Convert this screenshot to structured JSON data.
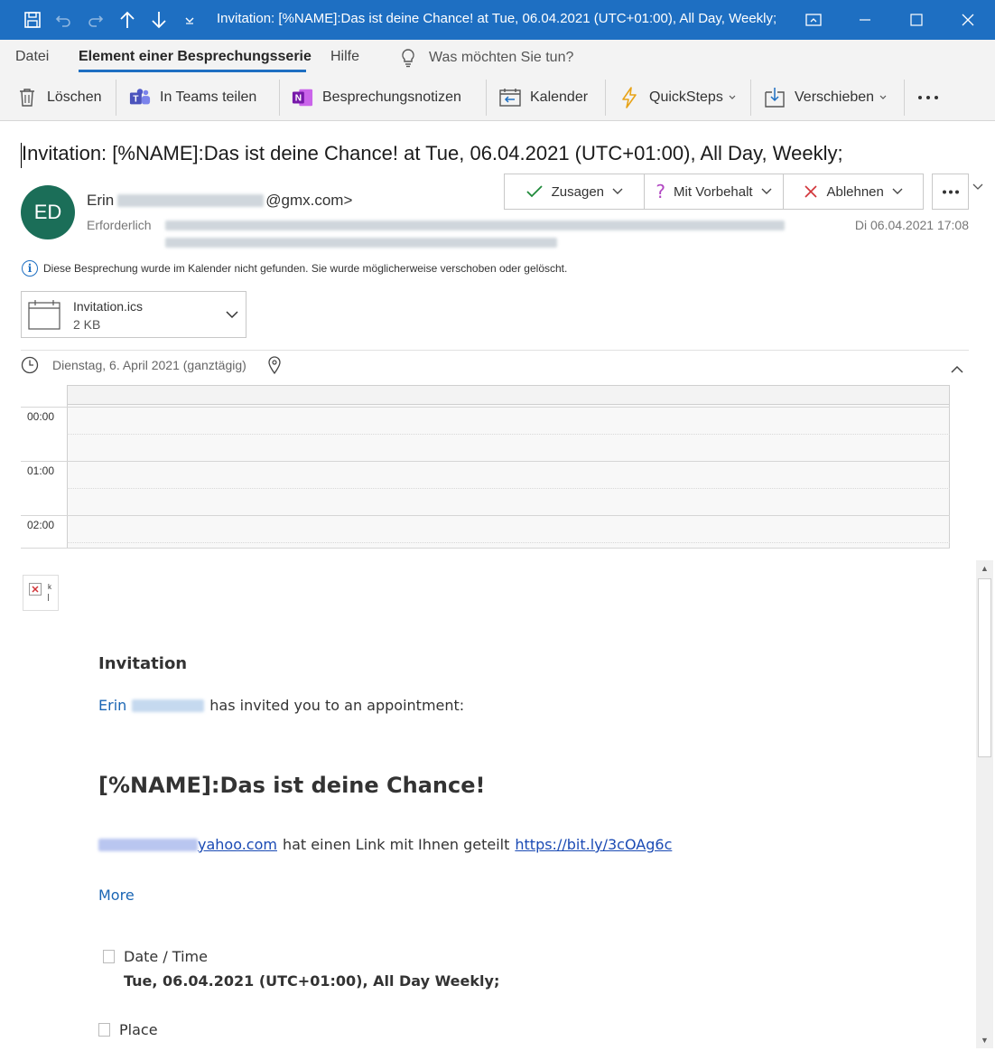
{
  "window": {
    "title": "Invitation: [%NAME]:Das ist deine Chance! at Tue, 06.04.2021 (UTC+01:00), All Day, Weekly;..."
  },
  "menu": {
    "tabs": [
      "Datei",
      "Element einer Besprechungsserie",
      "Hilfe"
    ],
    "tell_me": "Was möchten Sie tun?"
  },
  "ribbon": {
    "delete": "Löschen",
    "teams": "In Teams teilen",
    "notes": "Besprechungsnotizen",
    "calendar": "Kalender",
    "quicksteps": "QuickSteps",
    "move": "Verschieben"
  },
  "message": {
    "subject": "Invitation: [%NAME]:Das ist deine Chance! at Tue, 06.04.2021 (UTC+01:00), All Day, Weekly;",
    "avatar_initials": "ED",
    "sender_first": "Erin",
    "sender_domain": "@gmx.com>",
    "required_label": "Erforderlich",
    "received": "Di 06.04.2021 17:08",
    "responses": {
      "accept": "Zusagen",
      "tentative": "Mit Vorbehalt",
      "decline": "Ablehnen"
    },
    "info": "Diese Besprechung wurde im Kalender nicht gefunden. Sie wurde möglicherweise verschoben oder gelöscht.",
    "attachment": {
      "name": "Invitation.ics",
      "size": "2 KB"
    },
    "when": "Dienstag, 6. April 2021 (ganztägig)"
  },
  "calendar_preview": {
    "times": [
      "00:00",
      "01:00",
      "02:00"
    ]
  },
  "body": {
    "heading": "Invitation",
    "inviter": "Erin",
    "invite_text": "has invited you to an appointment:",
    "event_title": "[%NAME]:Das ist deine Chance!",
    "email_suffix": "yahoo.com",
    "share_text": "hat einen Link mit Ihnen geteilt",
    "share_link": "https://bit.ly/3cOAg6c",
    "more": "More",
    "datetime_label": "Date / Time",
    "datetime_value": "Tue, 06.04.2021 (UTC+01:00), All Day Weekly;",
    "place_label": "Place"
  },
  "colors": {
    "titlebar": "#1e6fc2",
    "avatar": "#1b6e58",
    "link": "#1a65b4"
  }
}
